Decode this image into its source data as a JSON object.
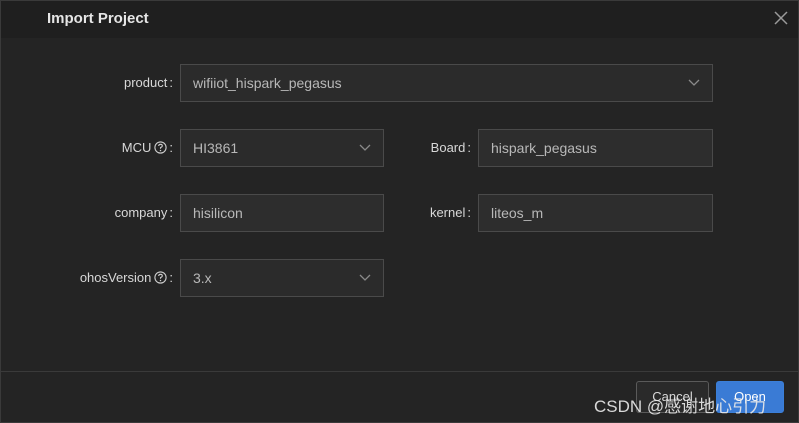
{
  "dialog": {
    "title": "Import Project"
  },
  "form": {
    "product": {
      "label": "product",
      "value": "wifiiot_hispark_pegasus"
    },
    "mcu": {
      "label": "MCU",
      "value": "HI3861"
    },
    "board": {
      "label": "Board",
      "value": "hispark_pegasus"
    },
    "company": {
      "label": "company",
      "value": "hisilicon"
    },
    "kernel": {
      "label": "kernel",
      "value": "liteos_m"
    },
    "ohos_version": {
      "label": "ohosVersion",
      "value": "3.x"
    },
    "colon": ":"
  },
  "footer": {
    "cancel_label": "Cancel",
    "open_label": "Open"
  },
  "watermark": "CSDN @感谢地心引力",
  "colors": {
    "background": "#242424",
    "title_bar": "#1f1f1f",
    "field_background": "#2b2b2b",
    "field_border": "#4a4a4a",
    "accent": "#3a7bd5"
  },
  "icons": {
    "close": "close-icon",
    "help": "help-circle-icon",
    "dropdown": "chevron-down-icon"
  }
}
